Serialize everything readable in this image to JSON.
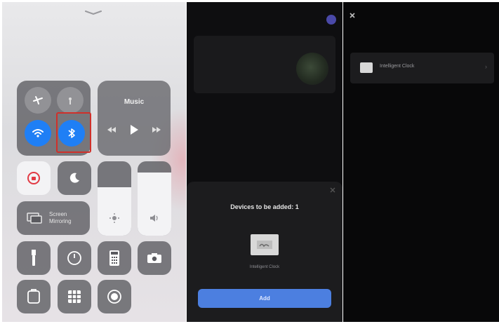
{
  "control_center": {
    "music": {
      "title": "Music"
    },
    "screen_mirroring": {
      "label": "Screen Mirroring"
    },
    "bluetooth_highlighted": true,
    "brightness_level": 0.65,
    "volume_level": 0.85
  },
  "app_screen": {
    "sheet": {
      "title": "Devices to be added: 1",
      "device_name": "Intelligent Clock",
      "button_label": "Add"
    }
  },
  "found_screen": {
    "device": {
      "name": "Intelligent Clock"
    }
  },
  "colors": {
    "ios_blue": "#1f7ff5",
    "highlight_red": "#d0302a",
    "add_button": "#4c7fe0"
  }
}
